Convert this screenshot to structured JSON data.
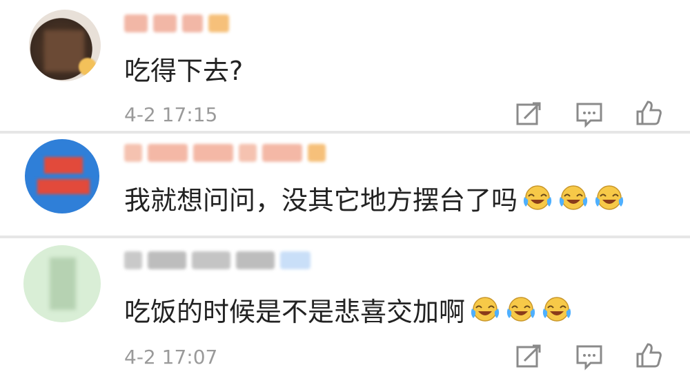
{
  "comments": [
    {
      "text": "吃得下去?",
      "time": "4-2 17:15",
      "emoji_count": 0
    },
    {
      "text": "我就想问问，没其它地方摆台了吗",
      "time": "",
      "emoji_count": 3
    },
    {
      "text": "吃饭的时候是不是悲喜交加啊",
      "time": "4-2 17:07",
      "emoji_count": 3
    }
  ],
  "icons": {
    "share": "share-icon",
    "comment": "comment-icon",
    "like": "like-icon",
    "emoji": "laughing-crying-emoji-icon"
  },
  "colors": {
    "text": "#222222",
    "time": "#9a9a9a",
    "divider": "#e6e6e6",
    "username_blur": "#f4b8a6",
    "icon": "#8a8a8a"
  }
}
